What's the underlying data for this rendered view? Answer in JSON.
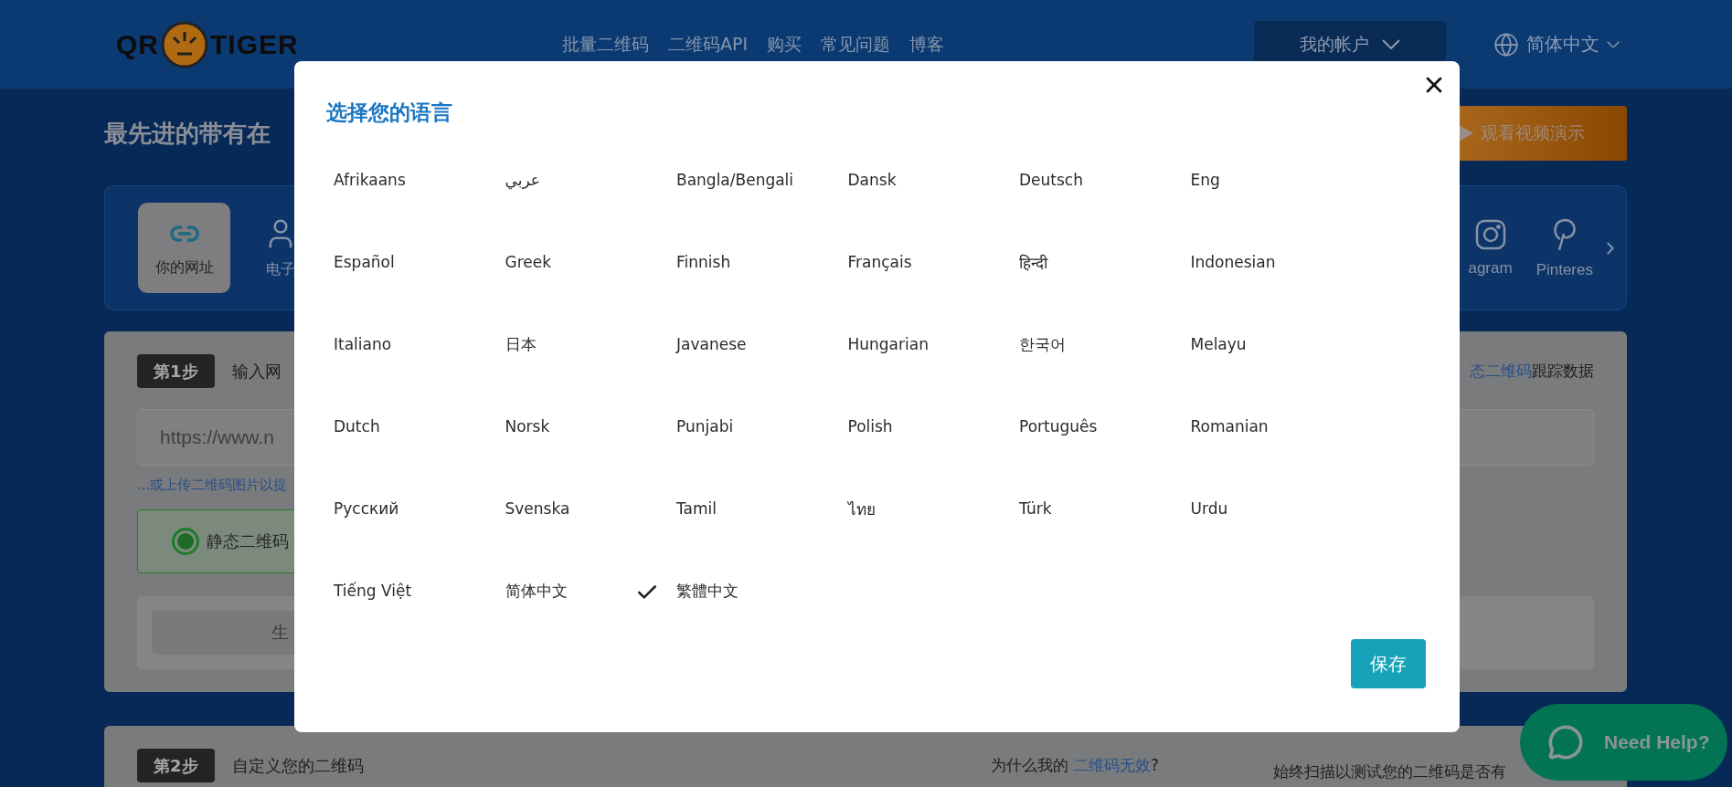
{
  "header": {
    "logo": {
      "left": "QR",
      "right": "TIGER"
    },
    "nav": [
      "批量二维码",
      "二维码API",
      "购买",
      "常见问题",
      "博客"
    ],
    "account_button": "我的帐户",
    "language": "简体中文",
    "language_menu_expanded": false
  },
  "hero": {
    "headline": "最先进的带有在",
    "video_button": "观看视频演示"
  },
  "type_tabs": {
    "left": [
      {
        "label": "你的网址",
        "selected": true,
        "kind": "link"
      },
      {
        "label": "电子",
        "selected": false,
        "kind": "person"
      }
    ],
    "right": [
      {
        "label": "agram",
        "selected": false,
        "kind": "instagram"
      },
      {
        "label": "Pinteres",
        "selected": false,
        "kind": "pinterest"
      }
    ]
  },
  "step1": {
    "badge": "第1步",
    "title": "输入网",
    "note_link": "态二维码",
    "note_text": "跟踪数据",
    "url_placeholder": "https://www.n",
    "upload_link": "...或上传二维码图片以提",
    "radio": {
      "label": "静态二维码",
      "selected": true
    },
    "generate_button": "生"
  },
  "step2": {
    "badge": "第2步",
    "title": "自定义您的二维码",
    "question_text": "为什么我的 ",
    "question_link": "二维码无效",
    "question_end": "?",
    "tip": "始终扫描以测试您的二维码是否有"
  },
  "help_button": "Need Help?",
  "modal": {
    "title": "选择您的语言",
    "languages": [
      {
        "label": "Afrikaans",
        "selected": false
      },
      {
        "label": "عربي",
        "selected": false
      },
      {
        "label": "Bangla/Bengali",
        "selected": false
      },
      {
        "label": "Dansk",
        "selected": false
      },
      {
        "label": "Deutsch",
        "selected": false
      },
      {
        "label": "Eng",
        "selected": false
      },
      {
        "label": "Español",
        "selected": false
      },
      {
        "label": "Greek",
        "selected": false
      },
      {
        "label": "Finnish",
        "selected": false
      },
      {
        "label": "Français",
        "selected": false
      },
      {
        "label": "हिन्दी",
        "selected": false
      },
      {
        "label": "Indonesian",
        "selected": false
      },
      {
        "label": "Italiano",
        "selected": false
      },
      {
        "label": "日本",
        "selected": false
      },
      {
        "label": "Javanese",
        "selected": false
      },
      {
        "label": "Hungarian",
        "selected": false
      },
      {
        "label": "한국어",
        "selected": false
      },
      {
        "label": "Melayu",
        "selected": false
      },
      {
        "label": "Dutch",
        "selected": false
      },
      {
        "label": "Norsk",
        "selected": false
      },
      {
        "label": "Punjabi",
        "selected": false
      },
      {
        "label": "Polish",
        "selected": false
      },
      {
        "label": "Português",
        "selected": false
      },
      {
        "label": "Romanian",
        "selected": false
      },
      {
        "label": "Русский",
        "selected": false
      },
      {
        "label": "Svenska",
        "selected": false
      },
      {
        "label": "Tamil",
        "selected": false
      },
      {
        "label": "ไทย",
        "selected": false
      },
      {
        "label": "Türk",
        "selected": false
      },
      {
        "label": "Urdu",
        "selected": false
      },
      {
        "label": "Tiếng Việt",
        "selected": false
      },
      {
        "label": "简体中文",
        "selected": false
      },
      {
        "label": "繁體中文",
        "selected": true
      }
    ],
    "save_button": "保存"
  }
}
